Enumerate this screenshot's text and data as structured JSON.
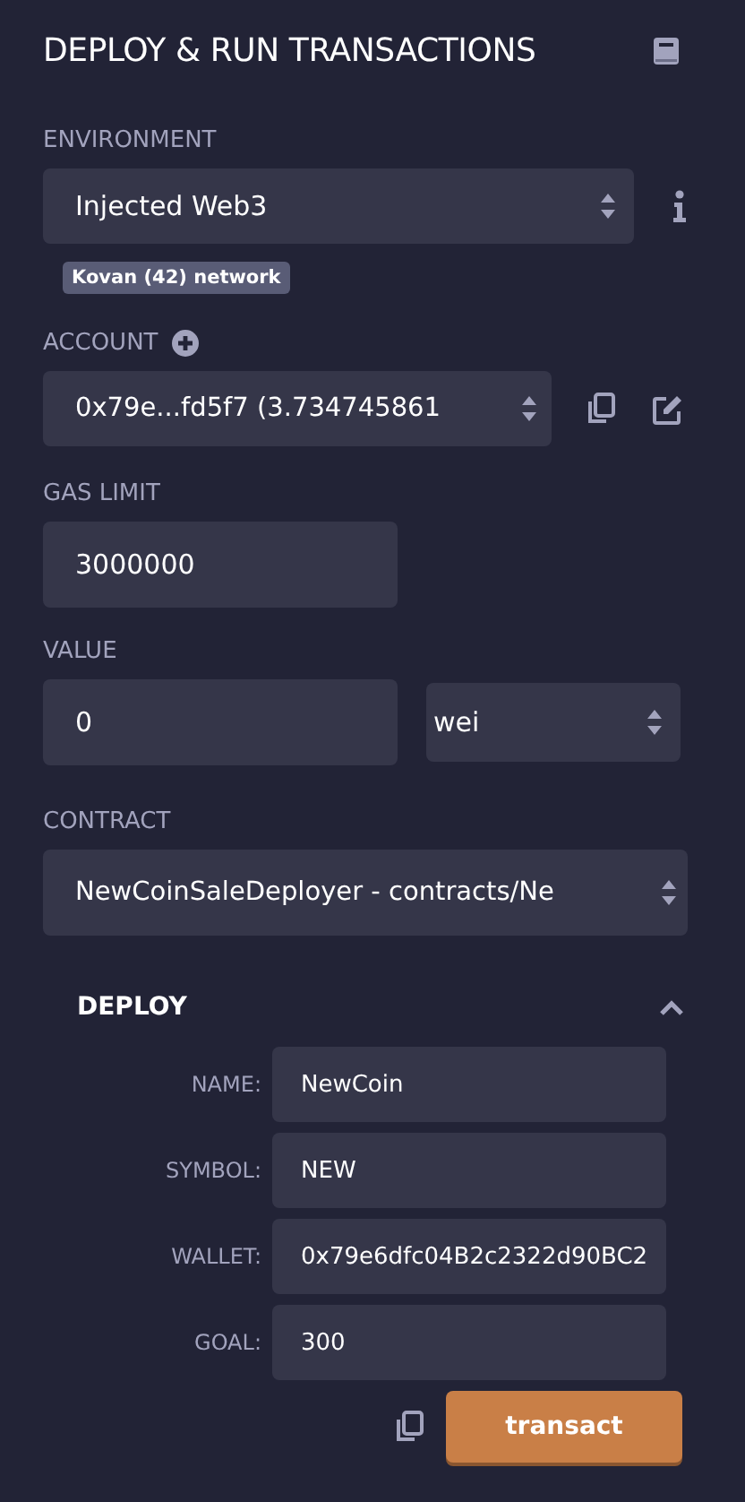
{
  "title": "DEPLOY & RUN TRANSACTIONS",
  "environment": {
    "label": "ENVIRONMENT",
    "value": "Injected Web3",
    "network": "Kovan (42) network"
  },
  "account": {
    "label": "ACCOUNT",
    "value": "0x79e...fd5f7 (3.734745861"
  },
  "gas_limit": {
    "label": "GAS LIMIT",
    "value": "3000000"
  },
  "value": {
    "label": "VALUE",
    "amount": "0",
    "unit": "wei"
  },
  "contract": {
    "label": "CONTRACT",
    "value": "NewCoinSaleDeployer - contracts/Ne"
  },
  "deploy": {
    "title": "DEPLOY",
    "expanded": true,
    "button": "transact",
    "params": [
      {
        "label": "NAME:",
        "value": "NewCoin"
      },
      {
        "label": "SYMBOL:",
        "value": "NEW"
      },
      {
        "label": "WALLET:",
        "value": "0x79e6dfc04B2c2322d90BC2"
      },
      {
        "label": "GOAL:",
        "value": "300"
      }
    ]
  }
}
